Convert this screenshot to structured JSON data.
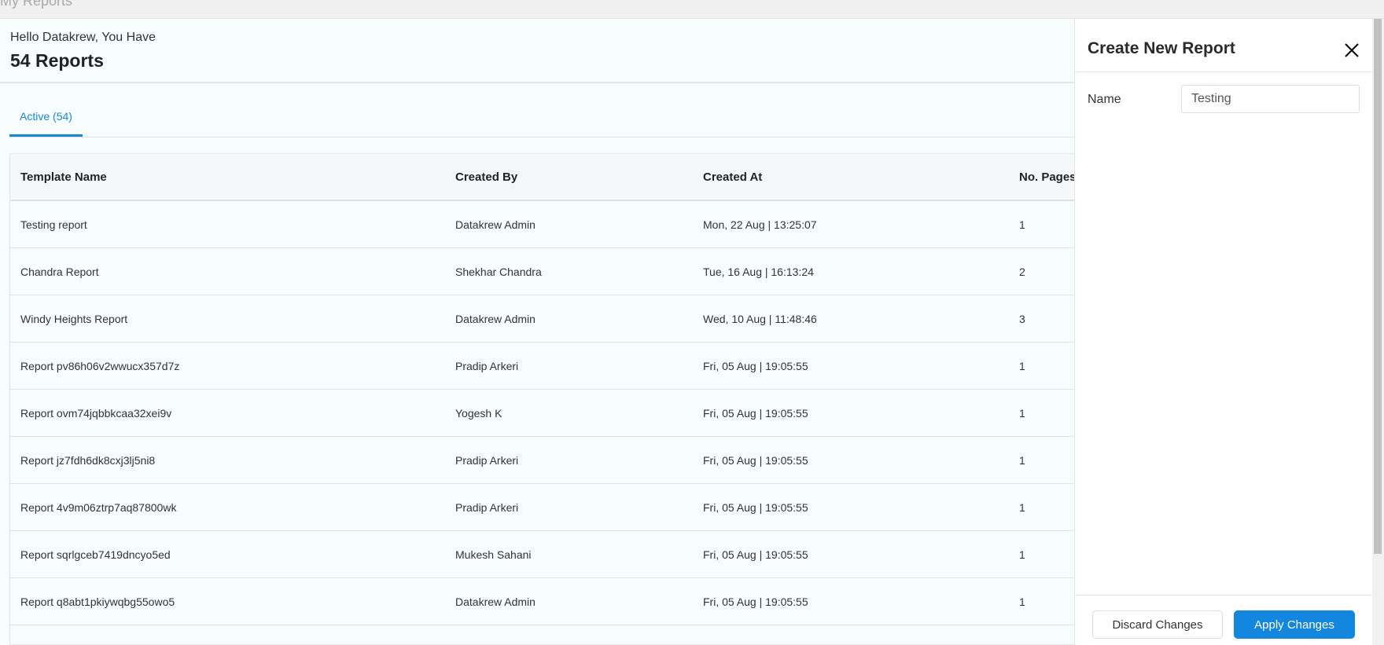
{
  "page_title": "My Reports",
  "header": {
    "greeting": "Hello Datakrew, You Have",
    "count": "54 Reports"
  },
  "tabs": [
    {
      "label": "Active (54)",
      "active": true
    }
  ],
  "table": {
    "columns": [
      "Template Name",
      "Created By",
      "Created At",
      "No. Pages"
    ],
    "rows": [
      [
        "Testing report",
        "Datakrew Admin",
        "Mon, 22 Aug | 13:25:07",
        "1"
      ],
      [
        "Chandra Report",
        "Shekhar Chandra",
        "Tue, 16 Aug | 16:13:24",
        "2"
      ],
      [
        "Windy Heights Report",
        "Datakrew Admin",
        "Wed, 10 Aug | 11:48:46",
        "3"
      ],
      [
        "Report pv86h06v2wwucx357d7z",
        "Pradip Arkeri",
        "Fri, 05 Aug | 19:05:55",
        "1"
      ],
      [
        "Report ovm74jqbbkcaa32xei9v",
        "Yogesh K",
        "Fri, 05 Aug | 19:05:55",
        "1"
      ],
      [
        "Report jz7fdh6dk8cxj3lj5ni8",
        "Pradip Arkeri",
        "Fri, 05 Aug | 19:05:55",
        "1"
      ],
      [
        "Report 4v9m06ztrp7aq87800wk",
        "Pradip Arkeri",
        "Fri, 05 Aug | 19:05:55",
        "1"
      ],
      [
        "Report sqrlgceb7419dncyo5ed",
        "Mukesh Sahani",
        "Fri, 05 Aug | 19:05:55",
        "1"
      ],
      [
        "Report q8abt1pkiywqbg55owo5",
        "Datakrew Admin",
        "Fri, 05 Aug | 19:05:55",
        "1"
      ]
    ]
  },
  "panel": {
    "title": "Create New Report",
    "name_label": "Name",
    "name_value": "Testing",
    "discard_label": "Discard Changes",
    "apply_label": "Apply Changes",
    "accent": "#1386dd"
  }
}
